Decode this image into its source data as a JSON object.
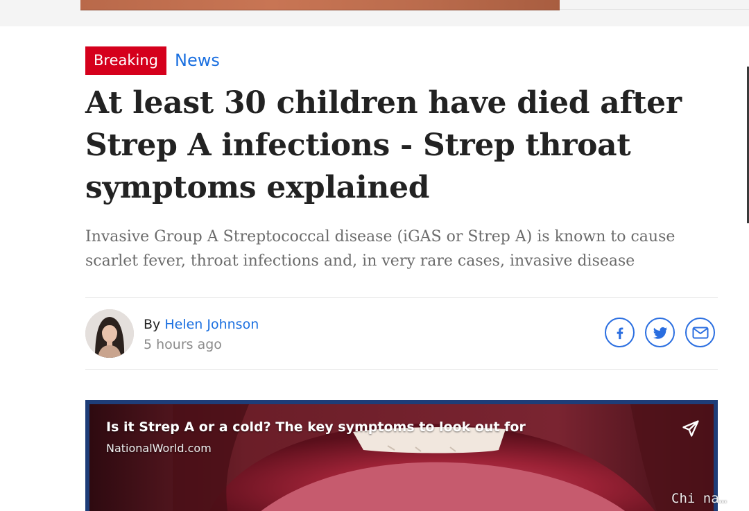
{
  "colors": {
    "breaking_red": "#d5001c",
    "link_blue": "#1a6fe0",
    "headline": "#222222",
    "standfirst": "#6b6b6b",
    "timestamp": "#8a8a8a",
    "share_blue": "#2a6ee0",
    "video_frame": "#1e3d78"
  },
  "article": {
    "badge": "Breaking",
    "section": "News",
    "headline": "At least 30 children have died after Strep A infections - Strep throat symptoms explained",
    "standfirst": "Invasive Group A Streptococcal disease (iGAS or Strep A) is known to cause scarlet fever, throat infections and, in very rare cases, invasive disease"
  },
  "byline": {
    "prefix": "By",
    "author": "Helen Johnson",
    "timestamp": "5 hours ago"
  },
  "share": {
    "icons": [
      "facebook-icon",
      "twitter-icon",
      "email-icon"
    ]
  },
  "video": {
    "title": "Is it Strep A or a cold? The key symptoms to look out for",
    "source": "NationalWorld.com",
    "share_icon": "send-icon"
  },
  "watermark": "Chi na…"
}
